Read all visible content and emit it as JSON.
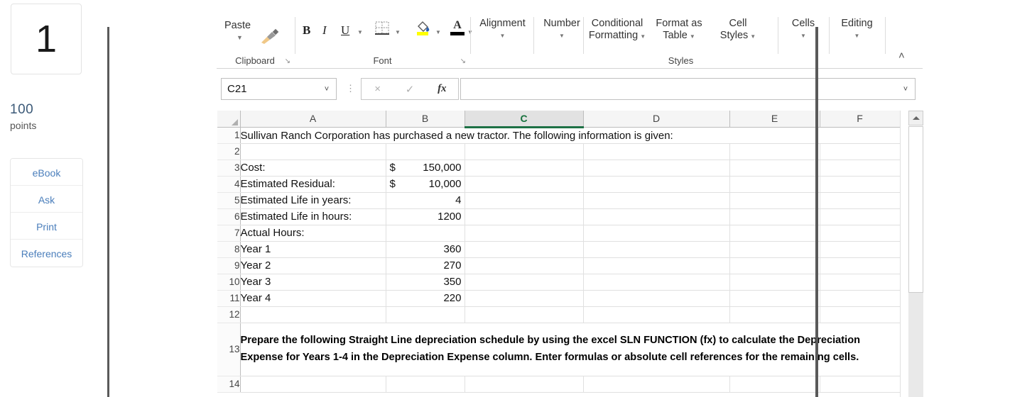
{
  "sidebar": {
    "question_number": "1",
    "points_value": "100",
    "points_label": "points",
    "buttons": [
      {
        "label": "eBook"
      },
      {
        "label": "Ask"
      },
      {
        "label": "Print"
      },
      {
        "label": "References"
      }
    ]
  },
  "ribbon": {
    "clipboard": {
      "paste_label": "Paste",
      "group_label": "Clipboard",
      "format_painter_name": "format-painter-icon",
      "dialog_launcher": "↘"
    },
    "font": {
      "bold": "B",
      "italic": "I",
      "underline": "U",
      "group_label": "Font",
      "dialog_launcher": "↘",
      "font_color_letter": "A"
    },
    "alignment": {
      "label": "Alignment"
    },
    "number": {
      "label": "Number"
    },
    "styles": {
      "conditional_formatting_line1": "Conditional",
      "conditional_formatting_line2": "Formatting",
      "format_as_table_line1": "Format as",
      "format_as_table_line2": "Table",
      "cell_styles_line1": "Cell",
      "cell_styles_line2": "Styles",
      "group_label": "Styles"
    },
    "cells": {
      "label": "Cells"
    },
    "editing": {
      "label": "Editing"
    },
    "collapse_ribbon": "˄"
  },
  "formula_area": {
    "name_box_value": "C21",
    "name_box_caret": "˅",
    "cancel_icon": "×",
    "confirm_icon": "✓",
    "fx_icon": "fx",
    "formula_value": "",
    "formula_placeholder": "",
    "expand_caret": "˅"
  },
  "grid": {
    "selected_column": "C",
    "columns": [
      "A",
      "B",
      "C",
      "D",
      "E",
      "F"
    ],
    "rows": [
      {
        "number": "1",
        "type": "spill",
        "text": "Sullivan Ranch Corporation has purchased a new tractor.  The following information is given:"
      },
      {
        "number": "2",
        "type": "normal",
        "a": "",
        "b": ""
      },
      {
        "number": "3",
        "type": "currency",
        "a": "Cost:",
        "symbol": "$",
        "b": "150,000"
      },
      {
        "number": "4",
        "type": "currency",
        "a": "Estimated Residual:",
        "symbol": "$",
        "b": "10,000"
      },
      {
        "number": "5",
        "type": "normal",
        "a": "Estimated Life in years:",
        "b": "4"
      },
      {
        "number": "6",
        "type": "normal",
        "a": "Estimated Life in hours:",
        "b": "1200"
      },
      {
        "number": "7",
        "type": "normal",
        "a": "Actual Hours:",
        "b": ""
      },
      {
        "number": "8",
        "type": "indent",
        "a": "Year 1",
        "b": "360"
      },
      {
        "number": "9",
        "type": "indent",
        "a": "Year 2",
        "b": "270"
      },
      {
        "number": "10",
        "type": "indent",
        "a": "Year 3",
        "b": "350"
      },
      {
        "number": "11",
        "type": "indent",
        "a": "Year 4",
        "b": "220"
      },
      {
        "number": "12",
        "type": "normal",
        "a": "",
        "b": ""
      },
      {
        "number": "13",
        "type": "merged",
        "text": "Prepare the following Straight Line depreciation schedule by using the excel SLN FUNCTION (fx) to calculate the Depreciation Expense for Years 1-4 in the Depreciation Expense column. Enter formulas or absolute cell references for the remaining cells."
      },
      {
        "number": "14",
        "type": "normal",
        "a": "",
        "b": ""
      }
    ]
  },
  "scrollbar": {
    "up_arrow_name": "scroll-up-arrow"
  },
  "colors": {
    "selection_green": "#1e7145",
    "link_blue": "#4a7ebb",
    "points_blue": "#3c5a78",
    "highlight_yellow": "#ffff00"
  }
}
